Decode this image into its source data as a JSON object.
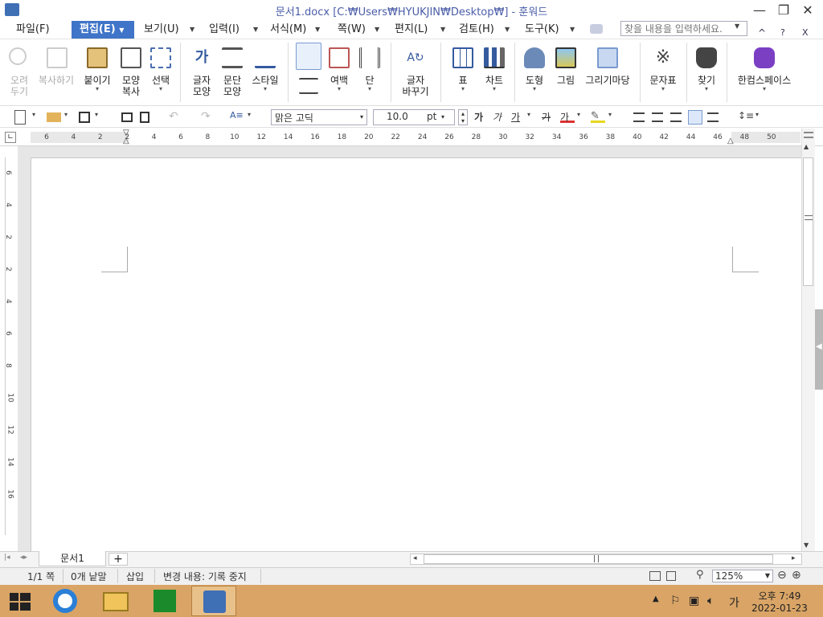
{
  "window": {
    "title": "문서1.docx [C:₩Users₩HYUKJIN₩Desktop₩] - 훈워드",
    "minimize": "—",
    "restore": "❐",
    "close": "✕"
  },
  "menu": {
    "items": [
      {
        "label": "파일(F)"
      },
      {
        "label": "편집(E)",
        "active": true
      },
      {
        "label": "보기(U)"
      },
      {
        "label": "입력(I)"
      },
      {
        "label": "서식(M)"
      },
      {
        "label": "쪽(W)"
      },
      {
        "label": "편지(L)"
      },
      {
        "label": "검토(H)"
      },
      {
        "label": "도구(K)"
      }
    ],
    "search_placeholder": "찾을 내용을 입력하세요.",
    "help_up": "^",
    "help_q": "?",
    "help_x": "X"
  },
  "ribbon": {
    "cut": "오려\n두기",
    "copy": "복사하기",
    "paste": "붙이기",
    "format_copy": "모양\n복사",
    "select": "선택",
    "char_shape": "글자\n모양",
    "para_shape": "문단\n모양",
    "style": "스타일",
    "margin": "여백",
    "column": "단",
    "char_replace": "글자\n바꾸기",
    "table": "표",
    "chart": "차트",
    "shape": "도형",
    "picture": "그림",
    "drawing_yard": "그리기마당",
    "symbol": "문자표",
    "find": "찾기",
    "hancom_space": "한컴스페이스",
    "dd": "▾"
  },
  "toolbar": {
    "font_face": "맑은 고딕",
    "font_size": "10.0",
    "font_unit": "pt",
    "bold": "가",
    "italic": "가",
    "underline": "가",
    "strike": "가",
    "color_char": "가",
    "caret": "▾",
    "colors": {
      "font": "#d33",
      "highlight": "#e8d820"
    }
  },
  "ruler": {
    "h_numbers": [
      "6",
      "4",
      "2",
      "2",
      "4",
      "6",
      "8",
      "10",
      "12",
      "14",
      "16",
      "18",
      "20",
      "22",
      "24",
      "26",
      "28",
      "30",
      "32",
      "34",
      "36",
      "38",
      "40",
      "42",
      "44",
      "46",
      "48",
      "50"
    ],
    "v_numbers": [
      "6",
      "4",
      "2",
      "2",
      "4",
      "6",
      "8",
      "10",
      "12",
      "14",
      "16"
    ]
  },
  "tabs": {
    "doc_tab": "문서1",
    "add": "+"
  },
  "status": {
    "page": "1/1 쪽",
    "words": "0개 낱말",
    "mode": "삽입",
    "changes": "변경 내용: 기록 중지",
    "zoom": "125%",
    "zoom_out": "⊖",
    "zoom_in": "⊕"
  },
  "taskbar": {
    "time": "오후 7:49",
    "date": "2022-01-23",
    "ime": "가"
  },
  "colors": {
    "accent": "#3f74c8",
    "taskbar": "#d9a466"
  }
}
